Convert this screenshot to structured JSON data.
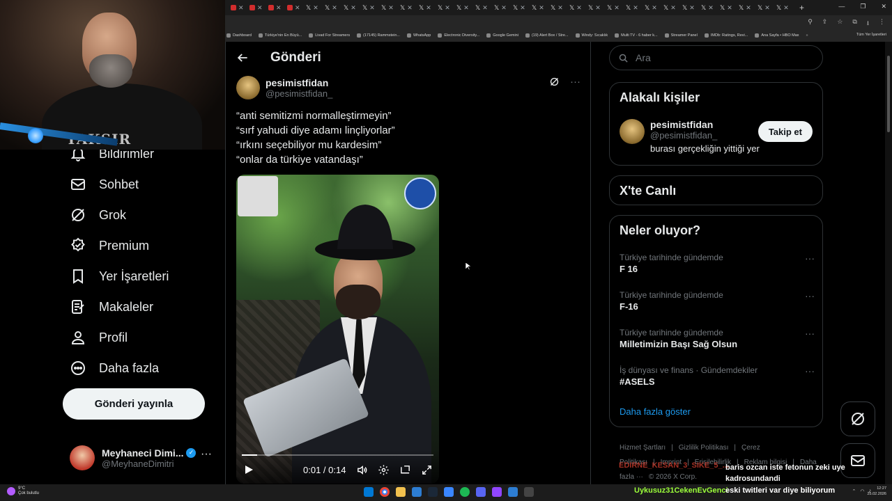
{
  "browser": {
    "bookmarks": [
      "Dashboard",
      "Türkiye'nin En Büyü...",
      "Livad For Streamers",
      "(17145) Rammstein...",
      "WhatsApp",
      "Electronic Diversity...",
      "Google Gemini",
      "(19) Alert Box / Stre...",
      "Windy: Sıcaklık",
      "Multi TV - 6 haber k...",
      "Streamer Panel",
      "IMDb: Ratings, Revi...",
      "Ana Sayfa • HBO Max"
    ],
    "all_bookmarks": "Tüm Yer İşaretleri"
  },
  "webcam": {
    "shirt_text": "TAKSIR"
  },
  "nav": {
    "notifications": "Bildirimler",
    "chat": "Sohbet",
    "grok": "Grok",
    "premium": "Premium",
    "bookmarks": "Yer İşaretleri",
    "articles": "Makaleler",
    "profile": "Profil",
    "more": "Daha fazla",
    "post_button": "Gönderi yayınla"
  },
  "account": {
    "display_name": "Meyhaneci Dimi...",
    "username": "@MeyhaneDimitri"
  },
  "main": {
    "title": "Gönderi",
    "author": {
      "display_name": "pesimistfidan",
      "username": "@pesimistfidan_"
    },
    "post_lines": [
      "“anti semitizmi normalleştirmeyin”",
      "“sırf yahudi diye adamı linçliyorlar”",
      "“ırkını seçebiliyor mu kardesim”",
      "“onlar da türkiye vatandaşı”"
    ],
    "video": {
      "time": "0:01 / 0:14",
      "progress": 0.08
    }
  },
  "right": {
    "search_placeholder": "Ara",
    "related": {
      "title": "Alakalı kişiler",
      "display_name": "pesimistfidan",
      "username": "@pesimistfidan_",
      "bio": "burası gerçekliğin yittiği yer",
      "follow": "Takip et"
    },
    "live_title": "X'te Canlı",
    "trends_title": "Neler oluyor?",
    "trends": [
      {
        "context": "Türkiye tarihinde gündemde",
        "name": "F 16"
      },
      {
        "context": "Türkiye tarihinde gündemde",
        "name": "F-16"
      },
      {
        "context": "Türkiye tarihinde gündemde",
        "name": "Milletimizin Başı Sağ Olsun"
      },
      {
        "context": "İş dünyası ve finans · Gündemdekiler",
        "name": "#ASELS"
      }
    ],
    "show_more": "Daha fazla göster",
    "footer": [
      "Hizmet Şartları",
      "|",
      "Gizlilik Politikası",
      "|",
      "Çerez Politikası",
      "|",
      "Imprint",
      "|",
      "Erişilebilirlik",
      "|",
      "Reklam bilgisi",
      "|",
      "Daha fazla ···",
      "© 2026 X Corp."
    ]
  },
  "stream_chat": {
    "user_overlay": "EDIRNE_KESAN_3_SIKE_5_...",
    "msg_line1": "baris ozcan iste fetonun zeki uye",
    "msg_line2": "kadrosundandi",
    "taskbar_user": "Uykusuz31CekenEvGenci",
    "taskbar_msg": "eski twitleri var diye biliyorum"
  },
  "taskbar": {
    "weather_temp": "9°C",
    "weather_desc": "Çok bulutlu",
    "time": "12:27",
    "date": "25.02.2026"
  },
  "colors": {
    "accent": "#1d9bf0",
    "bg": "#000000",
    "border": "#2f3336",
    "muted": "#71767b"
  }
}
